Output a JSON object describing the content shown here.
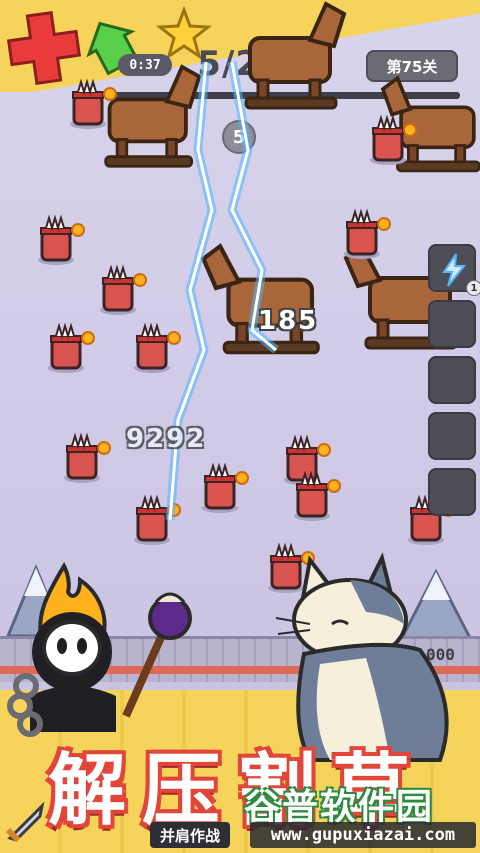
{
  "hud": {
    "timer": "0:37",
    "wave_progress": "5/20",
    "level": "第75关",
    "combo_count": "5"
  },
  "damage_numbers": [
    "185",
    "9292"
  ],
  "skill_slots": [
    {
      "icon": "lightning-skill-icon",
      "count": "1"
    },
    {
      "icon": "empty-slot",
      "count": ""
    },
    {
      "icon": "empty-slot",
      "count": ""
    },
    {
      "icon": "empty-slot",
      "count": ""
    },
    {
      "icon": "empty-slot",
      "count": ""
    }
  ],
  "fence_score_tail": "000",
  "promo": {
    "title_chars": [
      "解",
      "压",
      "割",
      "草"
    ],
    "subtitle": "并肩作战"
  },
  "watermark": {
    "title": "谷普软件园",
    "url": "www.gupuxiazai.com"
  },
  "colors": {
    "background": "#d9d4ec",
    "banner_yellow": "#f6d35a",
    "title_red": "#e2453a",
    "lightning": "#4fb6ff",
    "enemy_red": "#d9534f"
  }
}
